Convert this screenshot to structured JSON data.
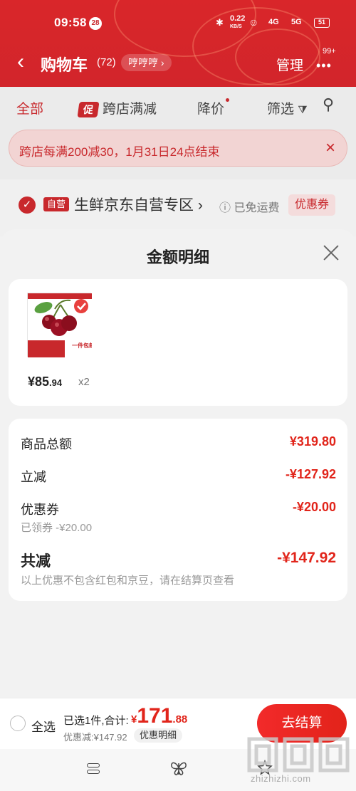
{
  "status_bar": {
    "time": "09:58",
    "notification_count": "28",
    "net_speed": "0.22",
    "net_unit": "KB/S",
    "sig1": "4G",
    "sig2": "5G",
    "battery": "51"
  },
  "header": {
    "title": "购物车",
    "count": "(72)",
    "filter_pill": "哼哼哼 ›",
    "manage": "管理",
    "more_badge": "99+"
  },
  "filters": {
    "all": "全部",
    "cross_store_tag": "促",
    "cross_store": "跨店满减",
    "price_drop": "降价",
    "filter": "筛选"
  },
  "promo_banner": {
    "text": "跨店每满200减30，1月31日24点结束"
  },
  "store": {
    "self_tag": "自营",
    "name": "生鲜京东自营专区",
    "shipping": "ⓘ 已免运费",
    "coupon": "优惠券"
  },
  "sheet": {
    "title": "金额明细",
    "item": {
      "price_int": "¥85",
      "price_dec": ".94",
      "qty": "x2",
      "image_tag": "一件包邮"
    },
    "rows": {
      "goods_total_label": "商品总额",
      "goods_total_value": "¥319.80",
      "instant_off_label": "立减",
      "instant_off_value": "-¥127.92",
      "coupon_label": "优惠券",
      "coupon_value": "-¥20.00",
      "coupon_sub": "已领券 -¥20.00",
      "total_label": "共减",
      "total_value": "-¥147.92",
      "note": "以上优惠不包含红包和京豆，请在结算页查看"
    }
  },
  "checkout_bar": {
    "select_all": "全选",
    "selected_info": "已选1件,合计:",
    "currency": "¥",
    "total_int": "171",
    "total_dec": ".88",
    "discount": "优惠减:¥147.92",
    "detail_button": "优惠明细",
    "checkout_button": "去结算"
  },
  "watermark": {
    "domain": "zhizhizhi.com"
  },
  "colors": {
    "brand_red": "#d9262a",
    "price_red": "#e1251b"
  }
}
